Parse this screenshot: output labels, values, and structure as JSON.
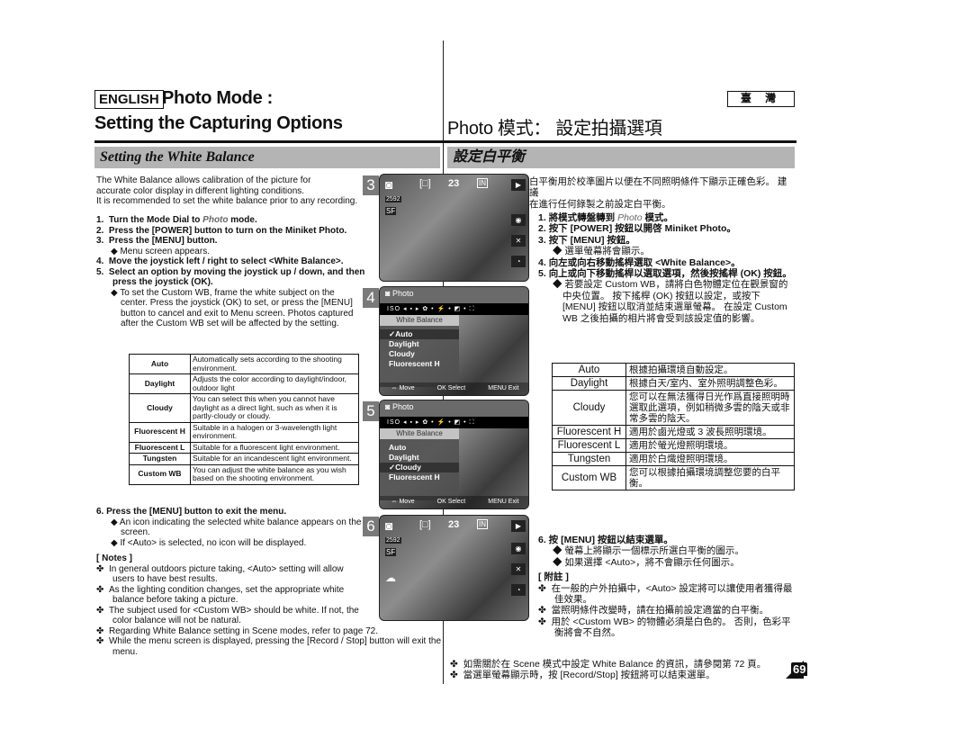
{
  "header": {
    "lang_badge": "ENGLISH",
    "title_line1": "Photo Mode :",
    "title_line2": "Setting the Capturing Options",
    "zh_badge": "臺 灣",
    "zh_title": "Photo  模式： 設定拍攝選項"
  },
  "section": {
    "en": "Setting the White Balance",
    "zh": "設定白平衡"
  },
  "en": {
    "intro": [
      "The White Balance allows calibration of the picture for",
      "accurate color display in different lighting conditions.",
      "It is recommended to set the white balance prior to any recording."
    ],
    "steps": [
      {
        "num": "1.",
        "pre": "Turn the Mode Dial to ",
        "em": "Photo",
        "post": " mode."
      },
      {
        "num": "2.",
        "text": "Press the [POWER] button to turn on the Miniket Photo."
      },
      {
        "num": "3.",
        "text": "Press the [MENU] button."
      },
      {
        "bullet": "Menu screen appears."
      },
      {
        "num": "4.",
        "text": "Move the joystick left / right to select <White Balance>."
      },
      {
        "num": "5.",
        "text": "Select an option by moving the joystick up / down, and then press the joystick (OK)."
      },
      {
        "bullet": "To set the Custom WB, frame the white subject on the center. Press the joystick (OK) to set, or press the [MENU] button to cancel and exit to Menu screen. Photos captured after the Custom WB set will be affected by the setting."
      }
    ],
    "table": [
      [
        "Auto",
        "Automatically sets according to the shooting environment."
      ],
      [
        "Daylight",
        "Adjusts the color according to daylight/indoor, outdoor light"
      ],
      [
        "Cloudy",
        "You can select this when you cannot have daylight as a direct light, such as when it is partly-cloudy or cloudy."
      ],
      [
        "Fluorescent H",
        "Suitable in a halogen or 3-wavelength light environment."
      ],
      [
        "Fluorescent L",
        "Suitable for a fluorescent light environment."
      ],
      [
        "Tungsten",
        "Suitable for an incandescent light environment."
      ],
      [
        "Custom WB",
        "You can adjust the white balance as you wish based on the shooting environment."
      ]
    ],
    "step6": "6.   Press the [MENU] button to exit the menu.",
    "step6_bullets": [
      "An icon indicating the selected white balance appears on the screen.",
      "If <Auto> is selected, no icon will be displayed."
    ],
    "notes_title": "[ Notes ]",
    "notes": [
      "In general outdoors picture taking, <Auto> setting will allow users to have best results.",
      "As the lighting condition changes, set the appropriate white balance before taking a picture.",
      "The subject used for <Custom WB> should be white. If not, the color balance will not be natural.",
      "Regarding White Balance setting in Scene modes, refer to page 72.",
      "While the menu screen is displayed, pressing the [Record / Stop] button will exit the menu."
    ]
  },
  "zh": {
    "intro": [
      "白平衡用於校準圖片以便在不同照明條件下顯示正確色彩。 建議",
      "在進行任何錄製之前設定白平衡。"
    ],
    "steps": [
      {
        "num": "1.",
        "pre": "將模式轉盤轉到 ",
        "em": "Photo",
        "post": " 模式。"
      },
      {
        "num": "2.",
        "text": "按下 [POWER] 按鈕以開啓 Miniket Photo。"
      },
      {
        "num": "3.",
        "text": "按下 [MENU] 按鈕。"
      },
      {
        "bullet": "選單螢幕將會顯示。"
      },
      {
        "num": "4.",
        "text": "向左或向右移動搖桿選取 <White Balance>。"
      },
      {
        "num": "5.",
        "text": "向上或向下移動搖桿以選取選項，然後按搖桿 (OK) 按鈕。"
      },
      {
        "bullet": "若要設定 Custom WB，請將白色物體定位在觀景窗的中央位置。 按下搖桿 (OK) 按鈕以設定，或按下 [MENU] 按鈕以取消並結束選單螢幕。 在設定 Custom WB 之後拍攝的相片將會受到該設定值的影響。"
      }
    ],
    "table": [
      [
        "Auto",
        "根據拍攝環境自動設定。"
      ],
      [
        "Daylight",
        "根據白天/室内、室外照明調整色彩。"
      ],
      [
        "Cloudy",
        "您可以在無法獲得日光作爲直接照明時選取此選項，例如稍微多雲的陰天或非常多雲的陰天。"
      ],
      [
        "Fluorescent H",
        "適用於鹵光燈或 3 波長照明環境。"
      ],
      [
        "Fluorescent L",
        "適用於螢光燈照明環境。"
      ],
      [
        "Tungsten",
        "適用於白熾燈照明環境。"
      ],
      [
        "Custom WB",
        "您可以根據拍攝環境調整您要的白平衡。"
      ]
    ],
    "step6": "6.   按 [MENU] 按鈕以結束選單。",
    "step6_bullets": [
      "螢幕上將顯示一個標示所選白平衡的圖示。",
      "如果選擇 <Auto>，將不會顯示任何圖示。"
    ],
    "notes_title": "[ 附註 ]",
    "notes": [
      "在一般的户外拍攝中，<Auto> 設定將可以讓使用者獲得最佳效果。",
      "當照明條件改變時，請在拍攝前設定適當的白平衡。",
      "用於 <Custom WB> 的物體必須是白色的。 否則，色彩平衡將會不自然。",
      "如需關於在 Scene 模式中設定 White Balance 的資訊，請參閱第 72 頁。",
      "當選單螢幕顯示時，按 [Record/Stop] 按鈕將可以結束選單。"
    ]
  },
  "screens": {
    "labels": [
      "3",
      "4",
      "5",
      "6"
    ],
    "osd": {
      "counter": "23",
      "memory": "IN",
      "size": "2592",
      "quality": "SF",
      "focus": "[□]"
    },
    "menu_mode": "Photo",
    "menu_bar": "ISO ◂ ▪ ▸ ✿ • ⚡ • ◩ • ⛶",
    "menu_title": "White Balance",
    "menu_items": [
      "Auto",
      "Daylight",
      "Cloudy",
      "Fluorescent H"
    ],
    "selected_screen4": "Auto",
    "selected_screen5": "Cloudy",
    "footer": [
      "⇔ Move",
      "OK Select",
      "MENU Exit"
    ]
  },
  "page_number": "69"
}
